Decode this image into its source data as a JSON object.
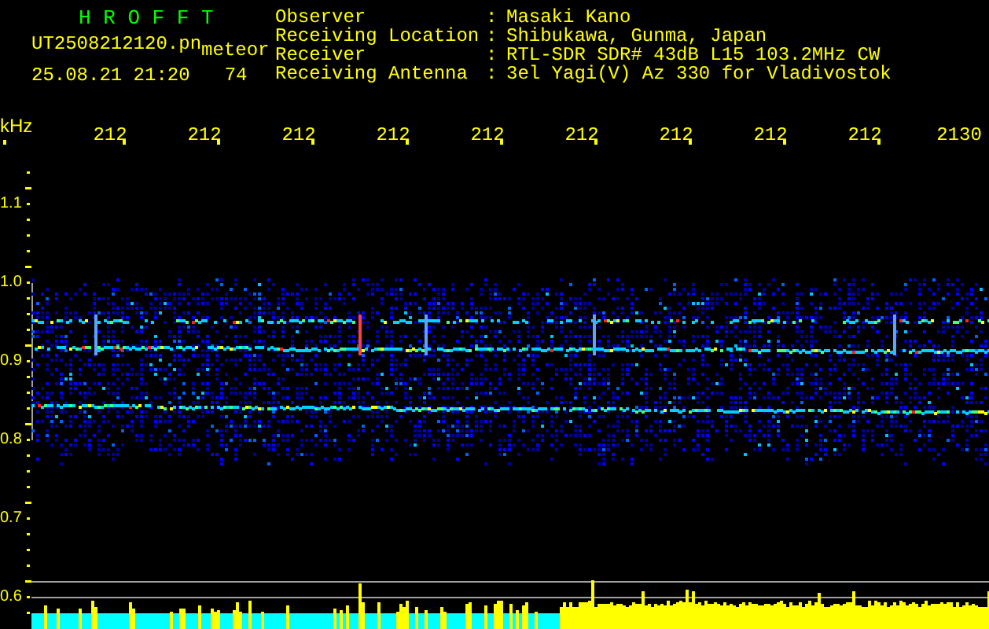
{
  "header": {
    "title": "H R O F F T",
    "filename": "UT2508212120.pn",
    "tag": "meteor",
    "datetime": "25.08.21 21:20",
    "count": "74"
  },
  "info": [
    {
      "label": "Observer",
      "separator": ":",
      "value": "Masaki Kano"
    },
    {
      "label": "Receiving Location",
      "separator": ":",
      "value": "Shibukawa, Gunma, Japan"
    },
    {
      "label": "Receiver",
      "separator": ":",
      "value": "RTL-SDR SDR# 43dB L15 103.2MHz CW"
    },
    {
      "label": "Receiving Antenna",
      "separator": ":",
      "value": "3el Yagi(V) Az 330 for Vladivostok"
    }
  ],
  "plot": {
    "y_unit": "kHz",
    "x_ticks": [
      "212",
      "212",
      "212",
      "212",
      "212",
      "212",
      "212",
      "212",
      "212",
      "2130"
    ],
    "y_ticks": [
      "1.1",
      "1.0",
      "0.9",
      "0.8",
      "0.7",
      "0.6"
    ]
  }
}
